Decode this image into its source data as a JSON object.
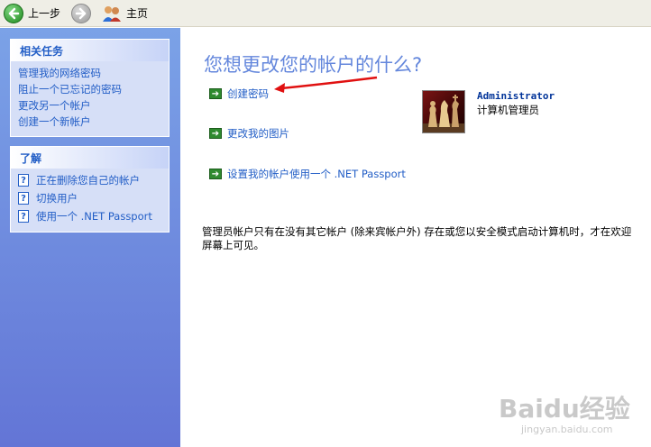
{
  "toolbar": {
    "back_label": "上一步",
    "home_label": "主页",
    "back_icon": "back-arrow-icon",
    "forward_icon": "forward-arrow-icon",
    "home_icon": "users-home-icon"
  },
  "related_tasks": {
    "title": "相关任务",
    "items": [
      {
        "label": "管理我的网络密码"
      },
      {
        "label": "阻止一个已忘记的密码"
      },
      {
        "label": "更改另一个帐户"
      },
      {
        "label": "创建一个新帐户"
      }
    ]
  },
  "learn_about": {
    "title": "了解",
    "items": [
      {
        "label": "正在删除您自己的帐户",
        "icon": "help-icon"
      },
      {
        "label": "切换用户",
        "icon": "help-icon"
      },
      {
        "label": "使用一个 .NET Passport",
        "icon": "help-icon"
      }
    ]
  },
  "main": {
    "title": "您想更改您的帐户的什么?",
    "actions": [
      {
        "label": "创建密码",
        "icon": "green-arrow-icon"
      },
      {
        "label": "更改我的图片",
        "icon": "green-arrow-icon"
      },
      {
        "label": "设置我的帐户使用一个 .NET Passport",
        "icon": "green-arrow-icon"
      }
    ],
    "account": {
      "name": "Administrator",
      "type": "计算机管理员",
      "picture": "chess-pieces-avatar"
    },
    "note": "管理员帐户只有在没有其它帐户 (除来宾帐户外) 存在或您以安全模式启动计算机时，才在欢迎屏幕上可见。"
  },
  "watermark": {
    "text": "Baidu经验",
    "sub": "jingyan.baidu.com"
  },
  "colors": {
    "link": "#215dc6",
    "title": "#6487dc",
    "annotation_arrow": "#e01010",
    "pane_gradient_top": "#7ba2e7",
    "pane_gradient_bottom": "#6375d6"
  }
}
